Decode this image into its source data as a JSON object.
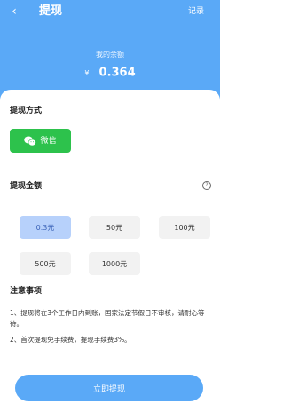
{
  "header": {
    "back_icon": "back-arrow-icon",
    "title": "提现",
    "records_label": "记录",
    "balance_label": "我的余额",
    "currency": "¥",
    "balance": "0.364"
  },
  "method_section": {
    "label": "提现方式",
    "wechat_icon": "wechat-icon",
    "wechat_label": "微信"
  },
  "amount_section": {
    "label": "提现金额",
    "help_icon": "help-icon",
    "options": [
      "0.3元",
      "50元",
      "100元",
      "500元",
      "1000元"
    ],
    "selected": "0.3元"
  },
  "notes": {
    "title": "注意事项",
    "items": [
      "1、提现将在3个工作日内到账，国家法定节假日不审核，请耐心等待。",
      "2、首次提现免手续费，提现手续费3%。"
    ]
  },
  "submit_label": "立即提现",
  "colors": {
    "header": "#5aa9f7",
    "wechat": "#2dc24c",
    "selected_bg": "#b7d1fb",
    "option_bg": "#f2f2f2",
    "button": "#5aa9f7"
  }
}
